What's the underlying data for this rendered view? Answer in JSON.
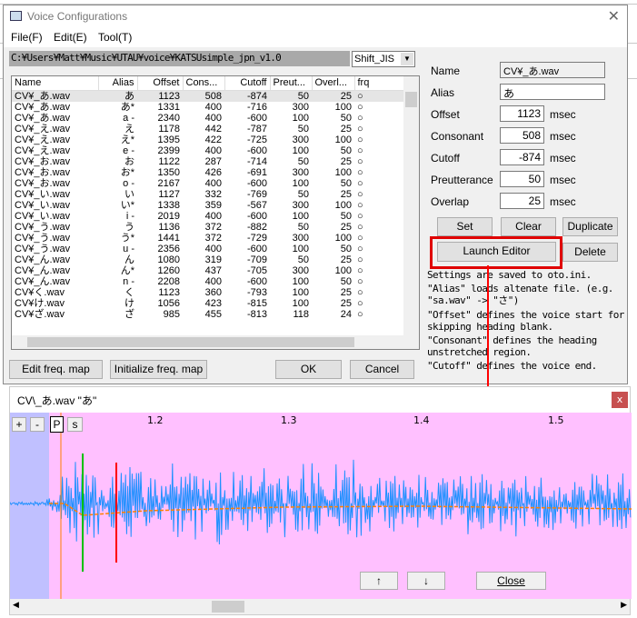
{
  "dialog": {
    "title": "Voice Configurations",
    "close_icon": "close-icon",
    "menu": [
      "File(F)",
      "Edit(E)",
      "Tool(T)"
    ],
    "path": "C:¥Users¥Matt¥Music¥UTAU¥voice¥KATSUsimple_jpn_v1.0",
    "encoding": "Shift_JIS",
    "table": {
      "headers": [
        "Name",
        "Alias",
        "Offset",
        "Cons...",
        "Cutoff",
        "Preut...",
        "Overl...",
        "frq"
      ],
      "rows": [
        [
          "CV¥_あ.wav",
          "あ",
          "1123",
          "508",
          "-874",
          "50",
          "25",
          "○"
        ],
        [
          "CV¥_あ.wav",
          "あ*",
          "1331",
          "400",
          "-716",
          "300",
          "100",
          "○"
        ],
        [
          "CV¥_あ.wav",
          "a -",
          "2340",
          "400",
          "-600",
          "100",
          "50",
          "○"
        ],
        [
          "CV¥_え.wav",
          "え",
          "1178",
          "442",
          "-787",
          "50",
          "25",
          "○"
        ],
        [
          "CV¥_え.wav",
          "え*",
          "1395",
          "422",
          "-725",
          "300",
          "100",
          "○"
        ],
        [
          "CV¥_え.wav",
          "e -",
          "2399",
          "400",
          "-600",
          "100",
          "50",
          "○"
        ],
        [
          "CV¥_お.wav",
          "お",
          "1122",
          "287",
          "-714",
          "50",
          "25",
          "○"
        ],
        [
          "CV¥_お.wav",
          "お*",
          "1350",
          "426",
          "-691",
          "300",
          "100",
          "○"
        ],
        [
          "CV¥_お.wav",
          "o -",
          "2167",
          "400",
          "-600",
          "100",
          "50",
          "○"
        ],
        [
          "CV¥_い.wav",
          "い",
          "1127",
          "332",
          "-769",
          "50",
          "25",
          "○"
        ],
        [
          "CV¥_い.wav",
          "い*",
          "1338",
          "359",
          "-567",
          "300",
          "100",
          "○"
        ],
        [
          "CV¥_い.wav",
          "i -",
          "2019",
          "400",
          "-600",
          "100",
          "50",
          "○"
        ],
        [
          "CV¥_う.wav",
          "う",
          "1136",
          "372",
          "-882",
          "50",
          "25",
          "○"
        ],
        [
          "CV¥_う.wav",
          "う*",
          "1441",
          "372",
          "-729",
          "300",
          "100",
          "○"
        ],
        [
          "CV¥_う.wav",
          "u -",
          "2356",
          "400",
          "-600",
          "100",
          "50",
          "○"
        ],
        [
          "CV¥_ん.wav",
          "ん",
          "1080",
          "319",
          "-709",
          "50",
          "25",
          "○"
        ],
        [
          "CV¥_ん.wav",
          "ん*",
          "1260",
          "437",
          "-705",
          "300",
          "100",
          "○"
        ],
        [
          "CV¥_ん.wav",
          "n -",
          "2208",
          "400",
          "-600",
          "100",
          "50",
          "○"
        ],
        [
          "CV¥く.wav",
          "く",
          "1123",
          "360",
          "-793",
          "100",
          "25",
          "○"
        ],
        [
          "CV¥け.wav",
          "け",
          "1056",
          "423",
          "-815",
          "100",
          "25",
          "○"
        ],
        [
          "CV¥ざ.wav",
          "ざ",
          "985",
          "455",
          "-813",
          "118",
          "24",
          "○"
        ]
      ]
    },
    "buttons": {
      "edit_freq": "Edit freq. map",
      "init_freq": "Initialize freq. map",
      "ok": "OK",
      "cancel": "Cancel",
      "set": "Set",
      "clear": "Clear",
      "duplicate": "Duplicate",
      "launch": "Launch Editor",
      "delete": "Delete"
    },
    "fields": {
      "name_label": "Name",
      "name": "CV¥_あ.wav",
      "alias_label": "Alias",
      "alias": "あ",
      "offset_label": "Offset",
      "offset": "1123",
      "consonant_label": "Consonant",
      "consonant": "508",
      "cutoff_label": "Cutoff",
      "cutoff": "-874",
      "preutterance_label": "Preutterance",
      "preutterance": "50",
      "overlap_label": "Overlap",
      "overlap": "25",
      "unit": "msec"
    },
    "help": [
      "Settings are saved to oto.ini.",
      "\"Alias\" loads altenate file. (e.g. \"sa.wav\" -> \"さ\")",
      "\"Offset\" defines the voice start for skipping heading blank.",
      "\"Consonant\" defines the heading unstretched region.",
      "\"Cutoff\" defines the voice end."
    ]
  },
  "editor": {
    "title": "CV\\_あ.wav \"あ\"",
    "close_label": "x",
    "tools": [
      "+",
      "-",
      "P",
      "s"
    ],
    "ticks": [
      "1.2",
      "1.3",
      "1.4",
      "1.5"
    ],
    "up": "↑",
    "down": "↓",
    "close": "Close",
    "colors": {
      "background": "#ffc0ff",
      "offset_region": "#c0c0ff",
      "wave": "#1e90ff",
      "envelope": "#ff8000",
      "highlight": "#ff0000"
    }
  }
}
